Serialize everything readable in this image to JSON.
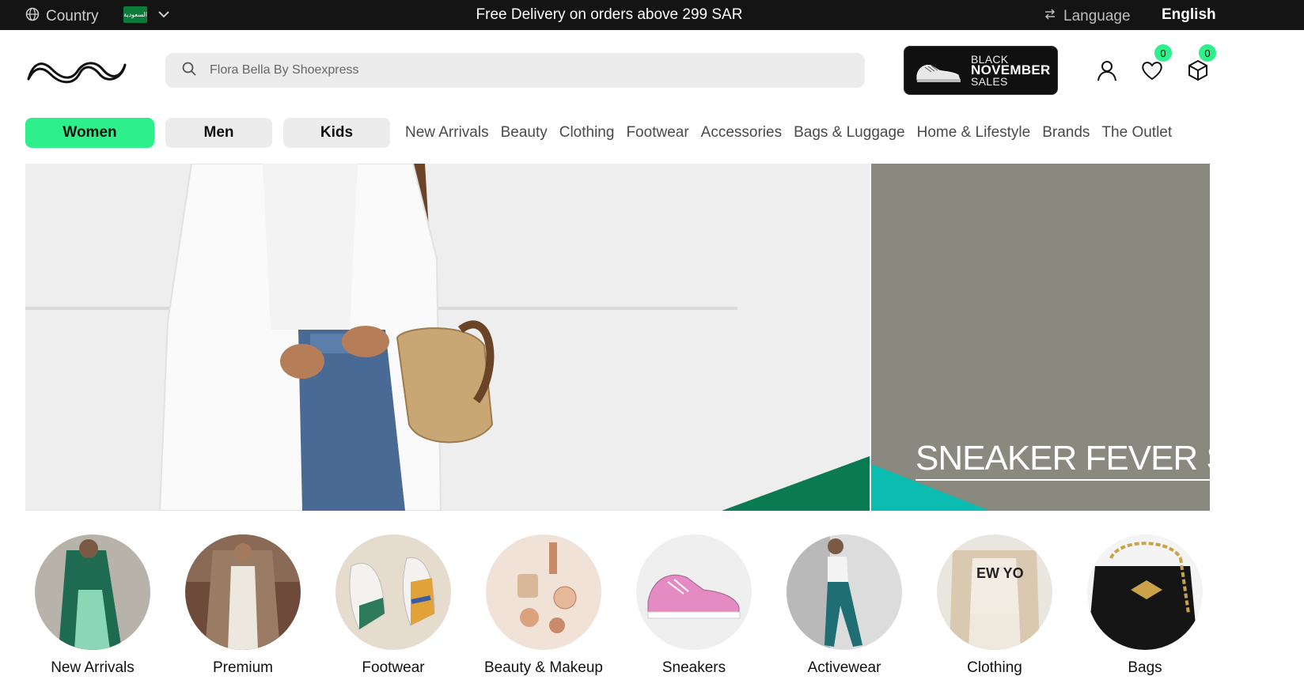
{
  "topbar": {
    "country_label": "Country",
    "flag_text": "السعودية",
    "promo_text": "Free Delivery on orders above 299 SAR",
    "language_label": "Language",
    "current_language": "English"
  },
  "search": {
    "placeholder": "Flora Bella By Shoexpress"
  },
  "promo_badge": {
    "line1": "BLACK",
    "line2": "NOVEMBER",
    "line3": "SALES"
  },
  "header": {
    "wishlist_count": "0",
    "cart_count": "0"
  },
  "gender_tabs": [
    {
      "label": "Women",
      "active": true
    },
    {
      "label": "Men",
      "active": false
    },
    {
      "label": "Kids",
      "active": false
    }
  ],
  "nav_links": [
    "New Arrivals",
    "Beauty",
    "Clothing",
    "Footwear",
    "Accessories",
    "Bags & Luggage",
    "Home & Lifestyle",
    "Brands",
    "The Outlet"
  ],
  "hero": {
    "side_banner_text": "SNEAKER FEVER SI"
  },
  "categories": [
    {
      "label": "New Arrivals"
    },
    {
      "label": "Premium"
    },
    {
      "label": "Footwear"
    },
    {
      "label": "Beauty & Makeup"
    },
    {
      "label": "Sneakers"
    },
    {
      "label": "Activewear"
    },
    {
      "label": "Clothing"
    },
    {
      "label": "Bags"
    }
  ],
  "colors": {
    "accent_green": "#2ef08a",
    "topbar_bg": "#141414",
    "pill_bg": "#ececec",
    "hero_green": "#0a7a52",
    "hero_teal": "#0bbcb0"
  },
  "icons": [
    "globe-icon",
    "chevron-down-icon",
    "swap-icon",
    "search-icon",
    "user-icon",
    "heart-icon",
    "box-icon"
  ]
}
